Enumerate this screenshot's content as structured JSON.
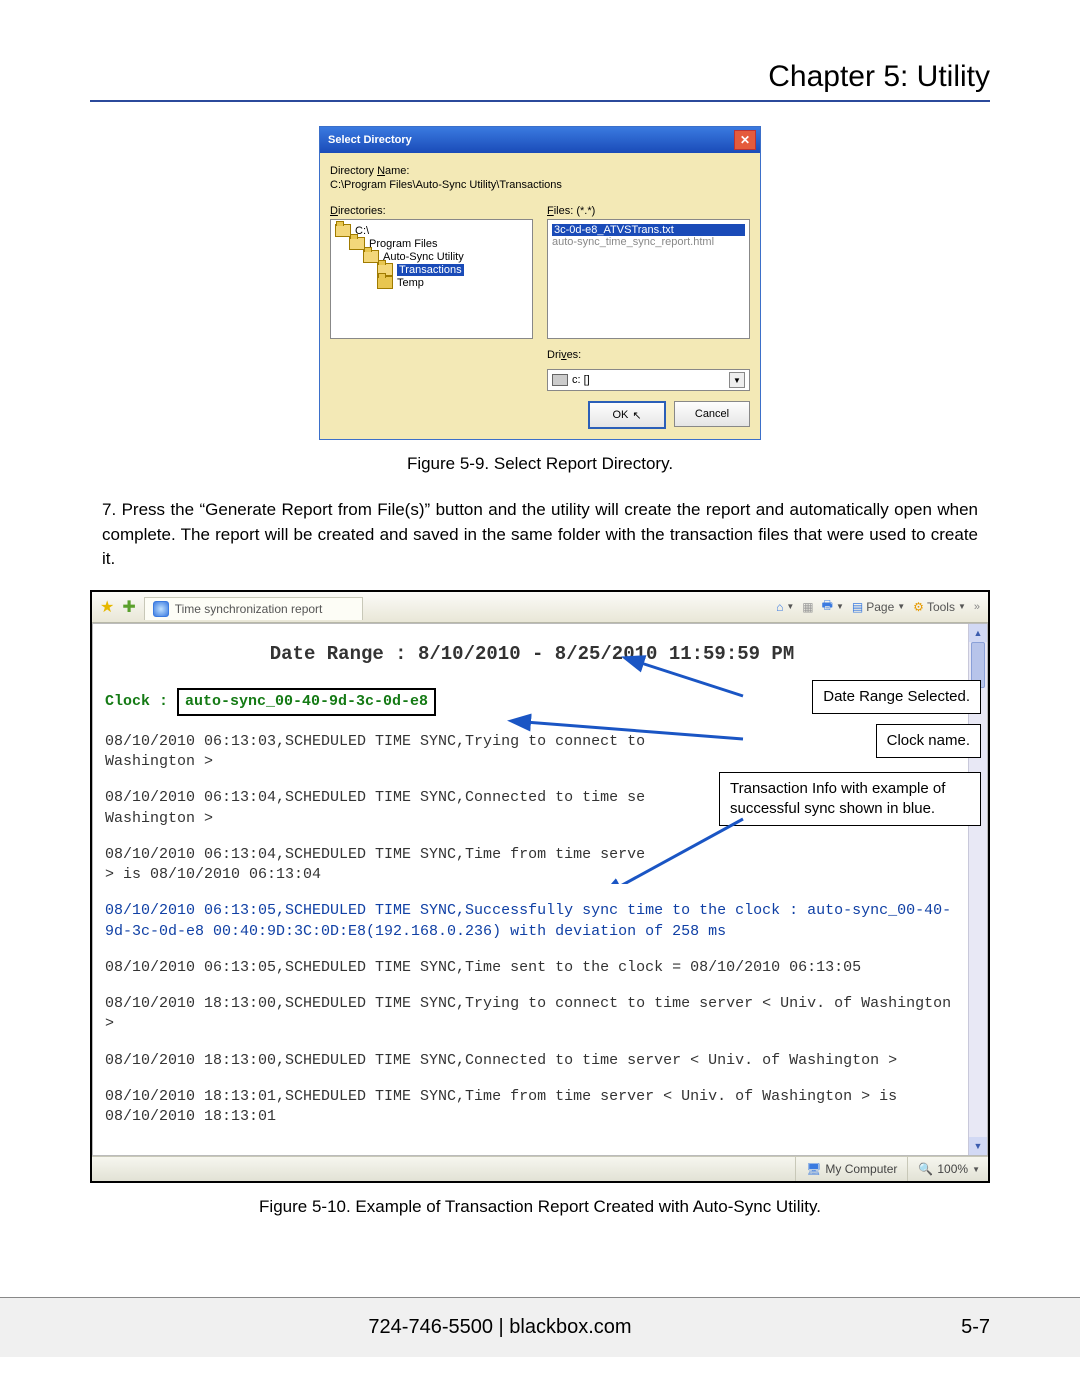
{
  "chapter_title": "Chapter 5: Utility",
  "dialog": {
    "title": "Select Directory",
    "dirname_label_pre": "Directory ",
    "dirname_label_u": "N",
    "dirname_label_post": "ame:",
    "path": "C:\\Program Files\\Auto-Sync Utility\\Transactions",
    "directories_label_u": "D",
    "directories_label_post": "irectories:",
    "tree": {
      "n1": "C:\\",
      "n2": "Program Files",
      "n3": "Auto-Sync Utility",
      "n4": "Transactions",
      "n5": "Temp"
    },
    "files_label_u": "F",
    "files_label_post": "iles: (*.*)",
    "file_selected": "3c-0d-e8_ATVSTrans.txt",
    "file_row2": "auto-sync_time_sync_report.html",
    "drives_label_pre": "Dri",
    "drives_label_u": "v",
    "drives_label_post": "es:",
    "drive_value": "c: []",
    "ok": "OK",
    "cancel": "Cancel"
  },
  "fig9_caption": "Figure 5-9.  Select Report Directory.",
  "step7": "7.  Press the “Generate Report from File(s)” button and the utility will create the report and automatically open when complete. The report will be created and saved in the same folder with the transaction files that were used to create it.",
  "ie": {
    "tab_title": "Time synchronization report",
    "page_label": "Page",
    "tools_label": "Tools"
  },
  "report": {
    "date_range": "Date Range : 8/10/2010 - 8/25/2010 11:59:59 PM",
    "clock_label": "Clock : ",
    "clock_name": "auto-sync_00-40-9d-3c-0d-e8",
    "log1": "08/10/2010 06:13:03,SCHEDULED TIME SYNC,Trying to connect to\nWashington >",
    "log2": "08/10/2010 06:13:04,SCHEDULED TIME SYNC,Connected to time se\nWashington >",
    "log3": "08/10/2010 06:13:04,SCHEDULED TIME SYNC,Time from time serve\n> is 08/10/2010 06:13:04",
    "log4": "08/10/2010 06:13:05,SCHEDULED TIME SYNC,Successfully sync time to the clock : auto-sync_00-40-9d-3c-0d-e8 00:40:9D:3C:0D:E8(192.168.0.236) with deviation of 258 ms",
    "log5": "08/10/2010 06:13:05,SCHEDULED TIME SYNC,Time sent to the clock = 08/10/2010 06:13:05",
    "log6": "08/10/2010 18:13:00,SCHEDULED TIME SYNC,Trying to connect to time server < Univ. of Washington >",
    "log7": "08/10/2010 18:13:00,SCHEDULED TIME SYNC,Connected to time server < Univ. of Washington >",
    "log8": "08/10/2010 18:13:01,SCHEDULED TIME SYNC,Time from time server < Univ. of Washington > is 08/10/2010 18:13:01"
  },
  "status": {
    "zone": "My Computer",
    "zoom": "100%"
  },
  "callouts": {
    "c1": "Date Range Selected.",
    "c2": "Clock name.",
    "c3": "Transaction Info with example of successful sync shown in blue."
  },
  "fig10_caption": "Figure 5-10.  Example of Transaction Report Created with Auto-Sync Utility.",
  "footer": {
    "phone": "724-746-5500",
    "sep": "   |   ",
    "site": "blackbox.com",
    "page": "5-7"
  }
}
